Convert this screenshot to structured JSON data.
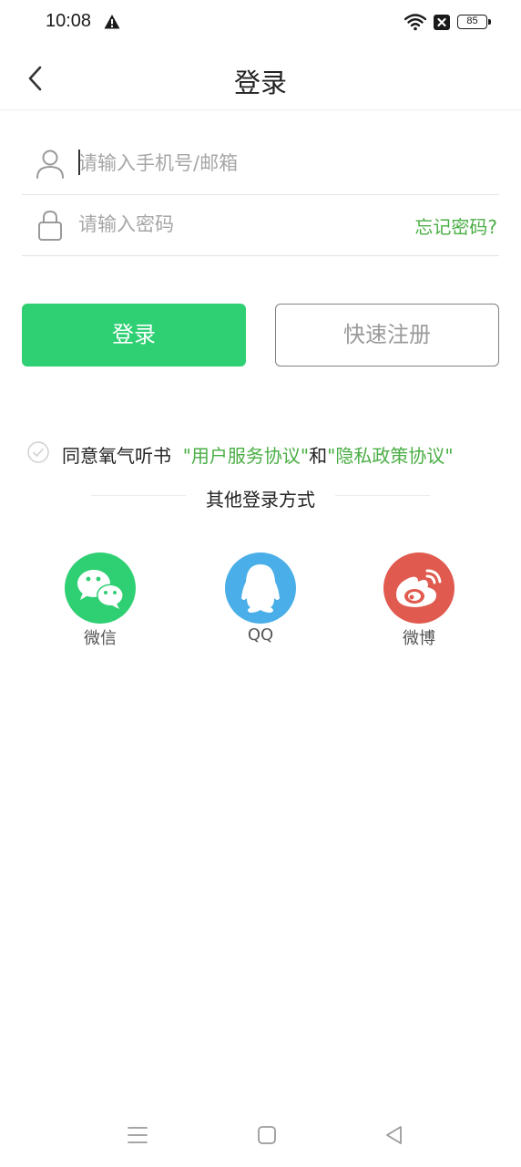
{
  "status_bar": {
    "time": "10:08",
    "battery": "85",
    "icons": [
      "warning-icon",
      "wifi-icon",
      "x-box-icon",
      "battery-icon"
    ]
  },
  "header": {
    "title": "登录",
    "back_icon": "chevron-left-icon"
  },
  "form": {
    "account_placeholder": "请输入手机号/邮箱",
    "account_value": "",
    "account_icon": "user-icon",
    "password_placeholder": "请输入密码",
    "password_value": "",
    "password_icon": "lock-icon",
    "forgot_label": "忘记密码?"
  },
  "buttons": {
    "login_label": "登录",
    "register_label": "快速注册"
  },
  "agreement": {
    "prefix": "同意氧气听书",
    "user_agreement": "\"用户服务协议\"",
    "and": "和",
    "privacy_policy": "\"隐私政策协议\"",
    "checked": false
  },
  "other_login": {
    "title": "其他登录方式",
    "providers": [
      {
        "label": "微信",
        "icon": "wechat-icon",
        "color": "#2fcf73"
      },
      {
        "label": "QQ",
        "icon": "qq-icon",
        "color": "#4aaee8"
      },
      {
        "label": "微博",
        "icon": "weibo-icon",
        "color": "#e05a4f"
      }
    ]
  },
  "colors": {
    "accent": "#2fcf73",
    "link": "#4aae45"
  }
}
